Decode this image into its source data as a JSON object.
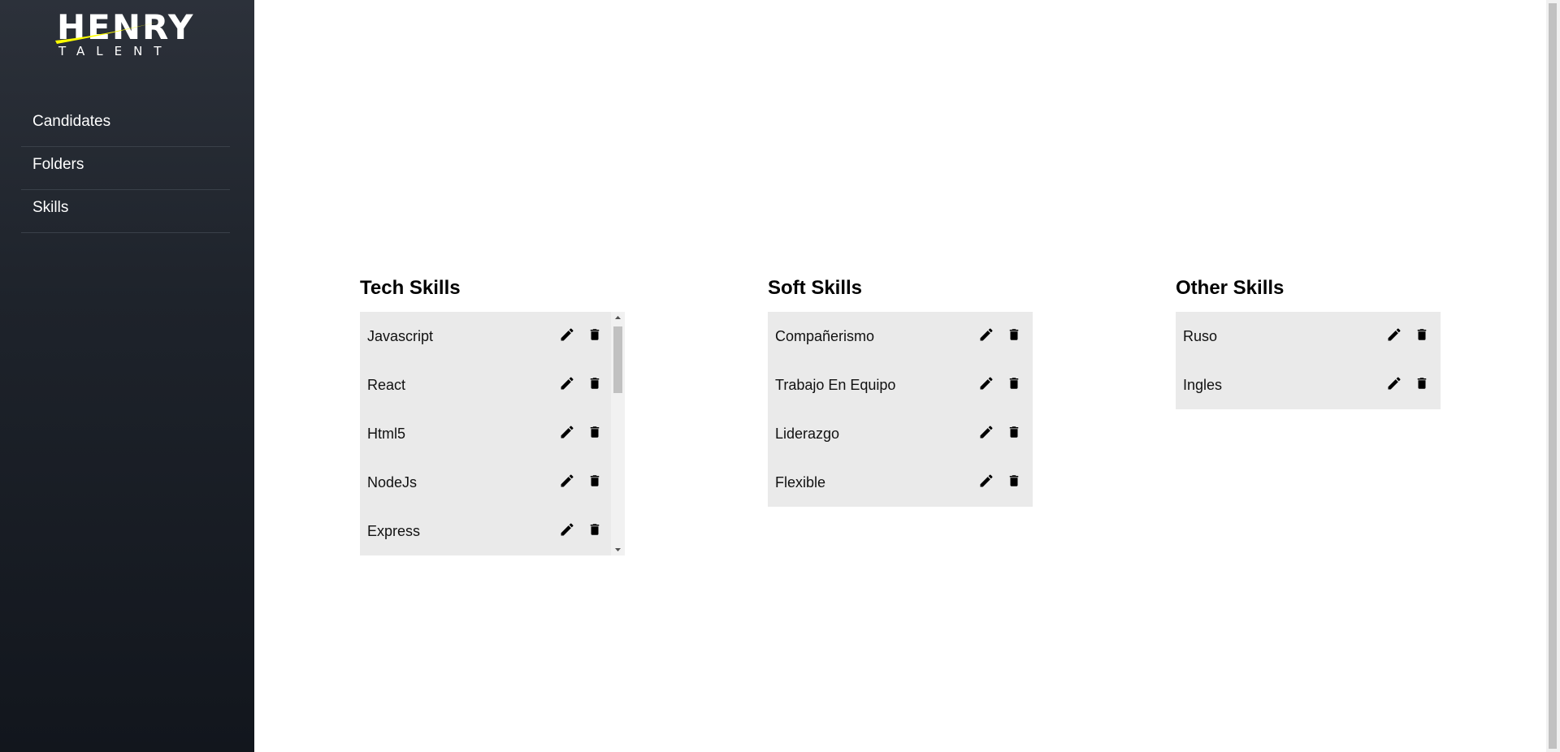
{
  "brand": {
    "name": "HENRY",
    "sub": "TALENT",
    "accent": "#ffff01"
  },
  "sidebar": {
    "items": [
      {
        "label": "Candidates"
      },
      {
        "label": "Folders"
      },
      {
        "label": "Skills"
      }
    ]
  },
  "columns": [
    {
      "title": "Tech Skills",
      "items": [
        "Javascript",
        "React",
        "Html5",
        "NodeJs",
        "Express"
      ]
    },
    {
      "title": "Soft Skills",
      "items": [
        "Compañerismo",
        "Trabajo En Equipo",
        "Liderazgo",
        "Flexible"
      ]
    },
    {
      "title": "Other Skills",
      "items": [
        "Ruso",
        "Ingles"
      ]
    }
  ],
  "icons": {
    "edit": "pencil-icon",
    "delete": "trash-icon"
  }
}
